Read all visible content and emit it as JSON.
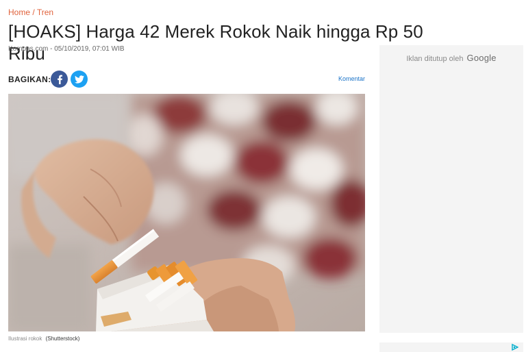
{
  "breadcrumb": {
    "home": "Home",
    "separator": "/",
    "section": "Tren"
  },
  "article": {
    "title": "[HOAKS] Harga 42 Merek Rokok Naik hingga Rp 50 Ribu",
    "meta": "Kompas.com - 05/10/2019, 07:01 WIB"
  },
  "share": {
    "label": "BAGIKAN:",
    "buttons": [
      {
        "icon": "facebook-icon",
        "color": "#3b5998"
      },
      {
        "icon": "twitter-icon",
        "color": "#1da1f2"
      }
    ],
    "comment_label": "Komentar"
  },
  "image": {
    "caption": "Ilustrasi rokok",
    "credit": "(Shutterstock)"
  },
  "ad": {
    "closed_text": "Iklan ditutup oleh",
    "brand": "Google",
    "choices_icon": "adchoices-icon"
  },
  "colors": {
    "accent": "#e0623b",
    "link": "#1a73c8",
    "facebook": "#3b5998",
    "twitter": "#1da1f2"
  }
}
